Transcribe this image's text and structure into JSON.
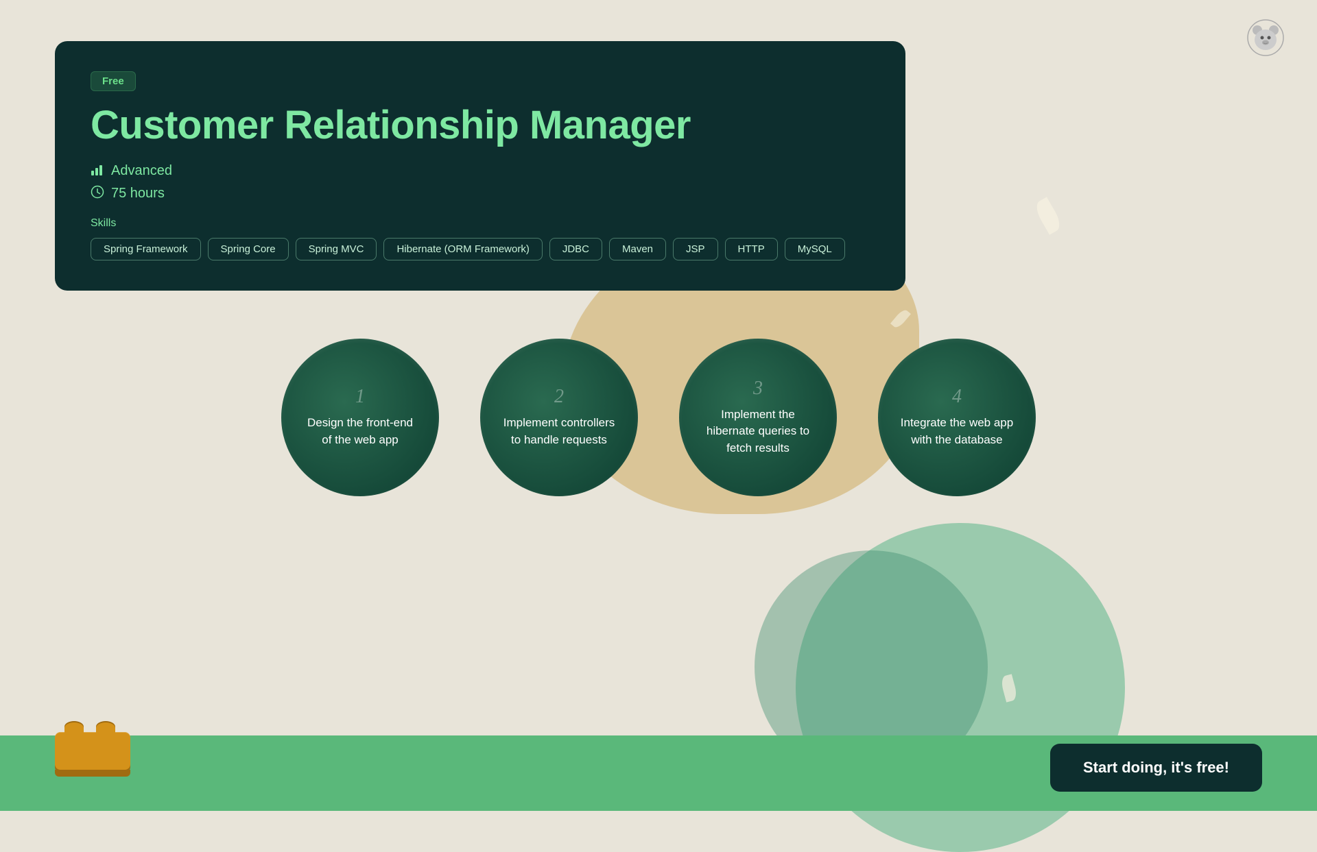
{
  "badge": {
    "label": "Free"
  },
  "course": {
    "title": "Customer Relationship Manager",
    "level": "Advanced",
    "duration": "75 hours",
    "skills_label": "Skills",
    "skills": [
      "Spring Framework",
      "Spring Core",
      "Spring MVC",
      "Hibernate (ORM Framework)",
      "JDBC",
      "Maven",
      "JSP",
      "HTTP",
      "MySQL"
    ]
  },
  "steps": [
    {
      "number": "1",
      "text": "Design the front-end of the web app"
    },
    {
      "number": "2",
      "text": "Implement controllers to handle requests"
    },
    {
      "number": "3",
      "text": "Implement the hibernate queries to fetch results"
    },
    {
      "number": "4",
      "text": "Integrate the web app with the database"
    }
  ],
  "cta": {
    "label": "Start doing, it's free!"
  },
  "colors": {
    "accent_green": "#7ee8a2",
    "dark_bg": "#0d2e2e",
    "badge_bg": "#1a4a3a"
  }
}
